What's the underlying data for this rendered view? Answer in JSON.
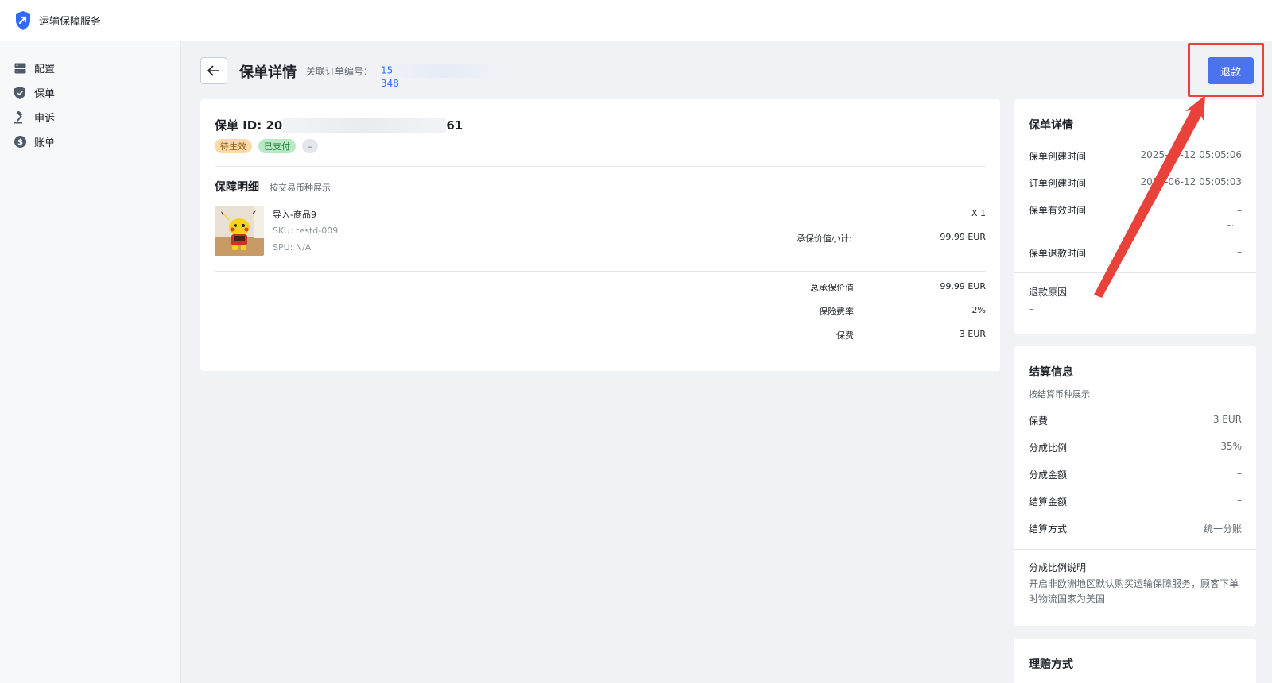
{
  "app": {
    "title": "运输保障服务"
  },
  "sidebar": {
    "items": [
      {
        "label": "配置",
        "icon": "config-icon"
      },
      {
        "label": "保单",
        "icon": "shield-icon"
      },
      {
        "label": "申诉",
        "icon": "gavel-icon"
      },
      {
        "label": "账单",
        "icon": "dollar-icon"
      }
    ]
  },
  "header": {
    "title": "保单详情",
    "order_label": "关联订单编号：",
    "order_prefix": "15",
    "order_suffix": "348",
    "refund_label": "退款"
  },
  "policy": {
    "id_label": "保单 ID:",
    "id_prefix": "20",
    "id_suffix": "61",
    "tags": [
      "待生效",
      "已支付",
      "–"
    ],
    "section_title": "保障明细",
    "section_sub": "按交易币种展示",
    "product": {
      "name": "导入-商品9",
      "sku": "SKU: testd-009",
      "spu": "SPU: N/A",
      "qty": "X 1",
      "subtotal_label": "承保价值小计:",
      "subtotal_value": "99.99 EUR"
    },
    "summary": [
      {
        "label": "总承保价值",
        "value": "99.99 EUR"
      },
      {
        "label": "保险费率",
        "value": "2%"
      },
      {
        "label": "保费",
        "value": "3 EUR"
      }
    ]
  },
  "details_card": {
    "title": "保单详情",
    "rows": [
      {
        "label": "保单创建时间",
        "value": "2025-06-12 05:05:06"
      },
      {
        "label": "订单创建时间",
        "value": "2025-06-12 05:05:03"
      },
      {
        "label": "保单有效时间",
        "value": "–",
        "value2": "~ –"
      },
      {
        "label": "保单退款时间",
        "value": "–"
      }
    ],
    "reason_label": "退款原因",
    "reason_value": "–"
  },
  "settlement_card": {
    "title": "结算信息",
    "sub": "按结算币种展示",
    "rows": [
      {
        "label": "保费",
        "value": "3 EUR"
      },
      {
        "label": "分成比例",
        "value": "35%"
      },
      {
        "label": "分成金额",
        "value": "–"
      },
      {
        "label": "结算金额",
        "value": "–"
      },
      {
        "label": "结算方式",
        "value": "统一分账"
      }
    ],
    "note_title": "分成比例说明",
    "note_text": "开启非欧洲地区默认购买运输保障服务，顾客下单时物流国家为美国"
  },
  "claims_card": {
    "title": "理赔方式"
  },
  "colors": {
    "primary": "#4b73f0",
    "annotation": "#e8423b",
    "link": "#3370ff"
  }
}
